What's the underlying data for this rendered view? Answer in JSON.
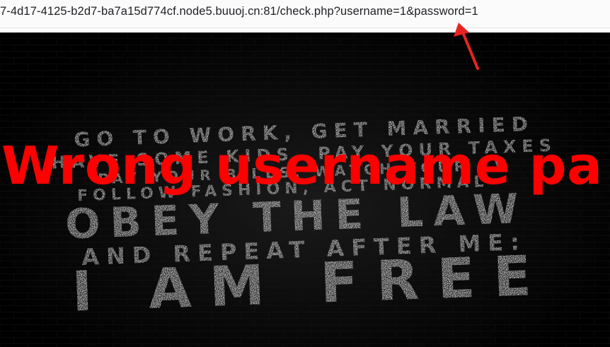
{
  "browser": {
    "url": "7-4d17-4125-b2d7-ba7a15d774cf.node5.buuoj.cn:81/check.php?username=1&password=1"
  },
  "page": {
    "message": "Wrong username pa"
  },
  "poster": {
    "lines": [
      "GO TO WORK, GET MARRIED",
      "HAVE SOME KIDS, PAY YOUR TAXES",
      "PAY YOUR BILLS, WATCH YOUR TV",
      "FOLLOW FASHION, ACT NORMAL",
      "OBEY THE LAW",
      "AND REPEAT AFTER ME:",
      "I AM FREE"
    ]
  },
  "annotation": {
    "arrow_color": "#e8231f"
  },
  "colors": {
    "message": "#ff0000",
    "poster_text": "#d9d9d9",
    "background": "#000000"
  }
}
